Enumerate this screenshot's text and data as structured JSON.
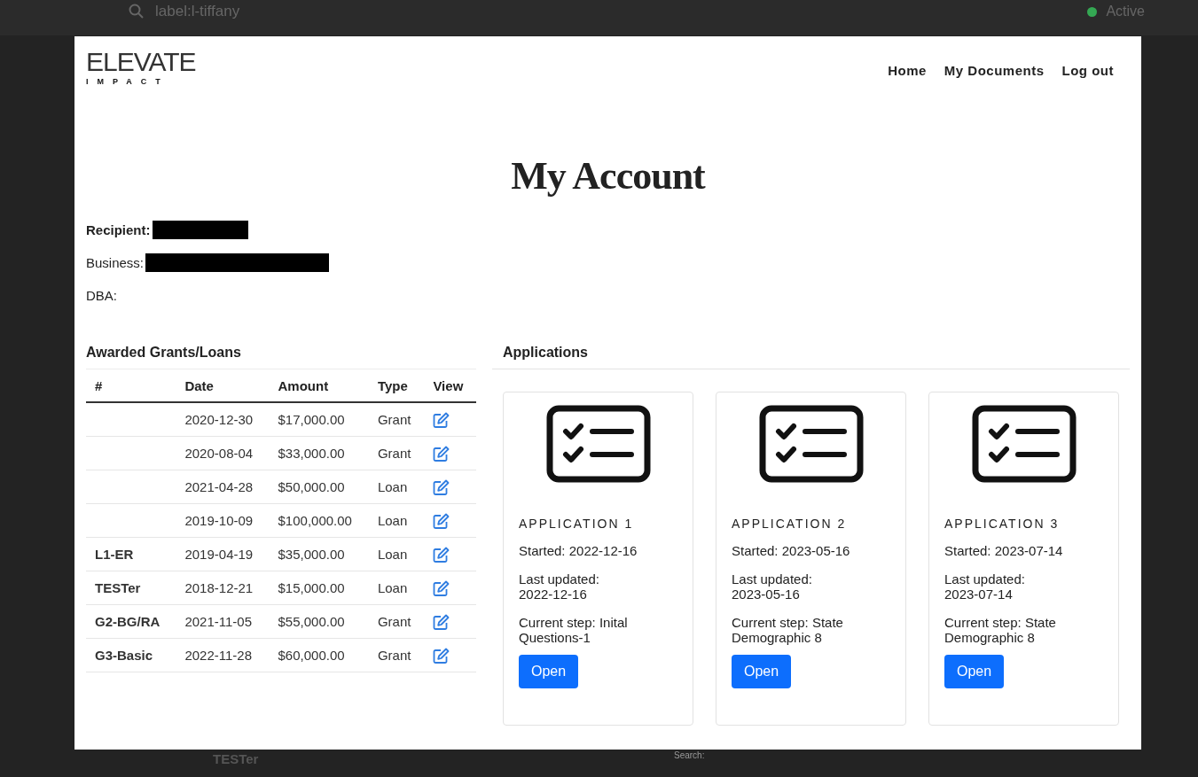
{
  "background_app": {
    "search_query": "label:l-tiffany",
    "status": {
      "label": "Active",
      "color": "#34a853"
    },
    "row_label": "TESTer",
    "search_label": "Search:"
  },
  "logo": {
    "word": "ELEVATE",
    "subword": "IMPACT"
  },
  "nav": [
    "Home",
    "My Documents",
    "Log out"
  ],
  "title": "My Account",
  "fields": [
    {
      "label": "Recipient:",
      "bold": true,
      "redacted": true
    },
    {
      "label": "Business:",
      "bold": false,
      "redacted": true
    },
    {
      "label": "DBA:",
      "bold": false,
      "redacted": false
    }
  ],
  "awards": {
    "title": "Awarded Grants/Loans",
    "columns": [
      "#",
      "Date",
      "Amount",
      "Type",
      "View"
    ],
    "rows": [
      {
        "id": "",
        "date": "2020-12-30",
        "amount": "$17,000.00",
        "type": "Grant"
      },
      {
        "id": "",
        "date": "2020-08-04",
        "amount": "$33,000.00",
        "type": "Grant"
      },
      {
        "id": "",
        "date": "2021-04-28",
        "amount": "$50,000.00",
        "type": "Loan"
      },
      {
        "id": "",
        "date": "2019-10-09",
        "amount": "$100,000.00",
        "type": "Loan"
      },
      {
        "id": "L1-ER",
        "date": "2019-04-19",
        "amount": "$35,000.00",
        "type": "Loan"
      },
      {
        "id": "TESTer",
        "date": "2018-12-21",
        "amount": "$15,000.00",
        "type": "Loan"
      },
      {
        "id": "G2-BG/RA",
        "date": "2021-11-05",
        "amount": "$55,000.00",
        "type": "Grant"
      },
      {
        "id": "G3-Basic",
        "date": "2022-11-28",
        "amount": "$60,000.00",
        "type": "Grant"
      }
    ]
  },
  "applications": {
    "title": "Applications",
    "cards": [
      {
        "name": "APPLICATION 1",
        "started": "Started: 2022-12-16",
        "updated": "Last updated: 2022-12-16",
        "step": "Current step: Inital Questions-1",
        "button": "Open"
      },
      {
        "name": "APPLICATION 2",
        "started": "Started: 2023-05-16",
        "updated": "Last updated: 2023-05-16",
        "step": "Current step: State Demographic 8",
        "button": "Open"
      },
      {
        "name": "APPLICATION 3",
        "started": "Started: 2023-07-14",
        "updated": "Last updated: 2023-07-14",
        "step": "Current step: State Demographic 8",
        "button": "Open"
      }
    ]
  }
}
